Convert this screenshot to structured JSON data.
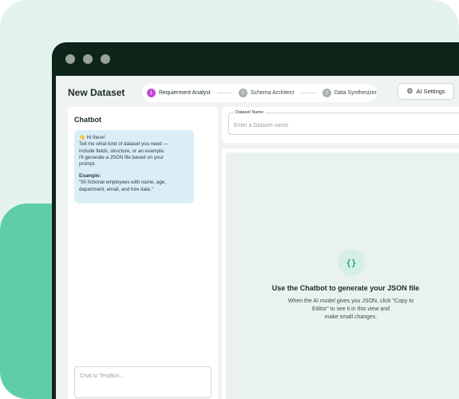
{
  "page": {
    "title": "New Dataset"
  },
  "steps": [
    {
      "number": "1",
      "label": "Requierment Analyst",
      "active": true
    },
    {
      "number": "2",
      "label": "Schema Architect",
      "active": false
    },
    {
      "number": "3",
      "label": "Data Synthesizer",
      "active": false
    }
  ],
  "toolbar": {
    "ai_settings_label": "AI Settings",
    "ai_settings_icon": "gear-icon"
  },
  "chatbot": {
    "title": "Chatbot",
    "message": {
      "greeting_emoji": "👋",
      "greeting": "Hi there!",
      "body_line1": "Tell me what kind of dataset you need —",
      "body_line2": "include fields, structure, or an example.",
      "body_line3": " I'll generate a JSON file based on your",
      "body_line4": "prompt.",
      "example_label": "Example:",
      "example_line1": "\"50 fictional employees with name, age,",
      "example_line2": "department, email, and hire date.\""
    },
    "input_placeholder": "Chat to TestBox..."
  },
  "dataset_name": {
    "label": "Dataset Name",
    "placeholder": "Enter a Dataset name",
    "value": ""
  },
  "editor": {
    "icon": "braces-icon",
    "empty_title": "Use the Chatbot to generate your JSON file",
    "empty_line1": "When the AI model gives you JSON, click \"Copy to",
    "empty_line2": "Editor\" to see it in this view and",
    "empty_line3": "make small changes."
  },
  "colors": {
    "accent_step": "#c04ad3",
    "brand_green": "#5fcdaa",
    "window_frame": "#0f2418"
  }
}
